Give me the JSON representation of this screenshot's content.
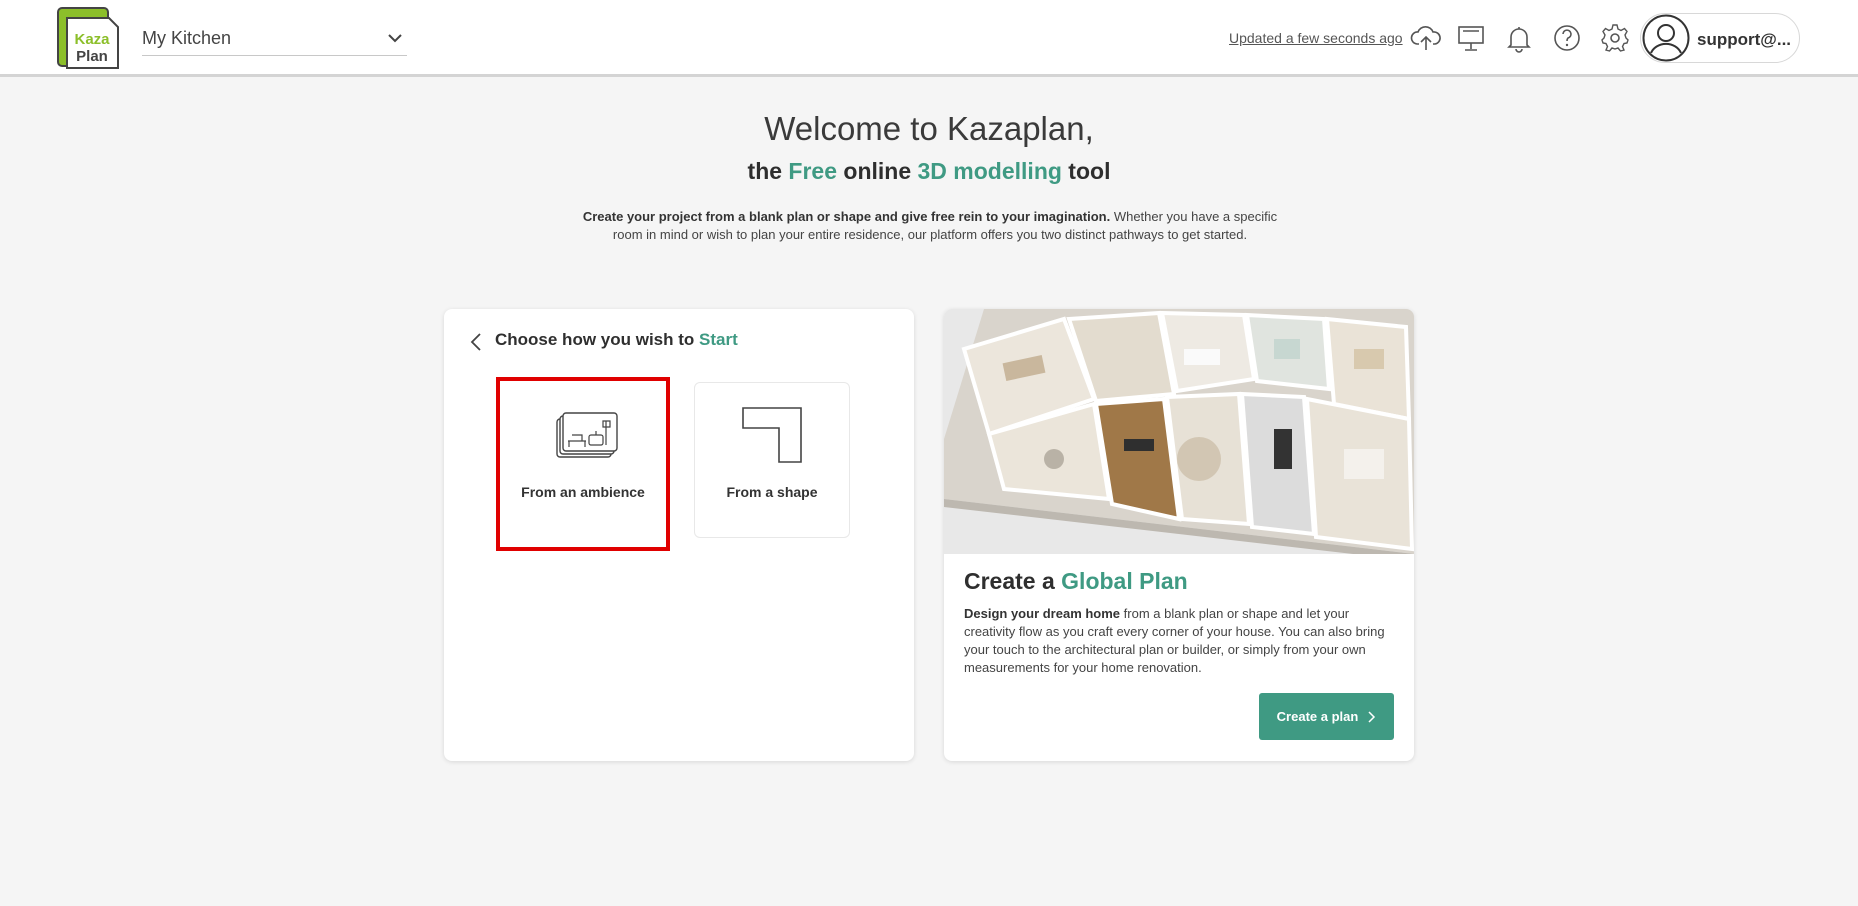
{
  "header": {
    "project_name": "My Kitchen",
    "updated_text": "Updated a few seconds ago",
    "user_email": "support@...",
    "logo_text_top": "Kaza",
    "logo_text_bottom": "Plan"
  },
  "welcome": {
    "title": "Welcome to Kazaplan,",
    "sub_the": "the ",
    "sub_free": "Free",
    "sub_online": " online ",
    "sub_3d": "3D modelling",
    "sub_tool": " tool",
    "desc_bold": "Create your project from a blank plan or shape and give free rein to your imagination.",
    "desc_rest": " Whether you have a specific room in mind or wish to plan your entire residence, our platform offers you two distinct pathways to get started."
  },
  "choose": {
    "title_prefix": "Choose how you wish to ",
    "title_accent": "Start",
    "options": [
      {
        "label": "From an ambience",
        "icon": "ambience-icon",
        "selected": true
      },
      {
        "label": "From a shape",
        "icon": "l-shape-icon",
        "selected": false
      }
    ]
  },
  "global_plan": {
    "title_prefix": "Create a ",
    "title_accent": "Global Plan",
    "desc_bold": "Design your dream home",
    "desc_rest": " from a blank plan or shape and let your creativity flow as you craft every corner of your house. You can also bring your touch to the architectural plan or builder, or simply from your own measurements for your home renovation.",
    "button_label": "Create a plan"
  },
  "colors": {
    "accent": "#3f9a83",
    "selection": "#e00000",
    "logo_green": "#8cbf2a"
  },
  "icons": [
    "chevron-down-icon",
    "cloud-upload-icon",
    "monitor-icon",
    "bell-icon",
    "help-icon",
    "gear-icon",
    "user-avatar-icon",
    "chevron-left-icon",
    "chevron-right-icon"
  ]
}
